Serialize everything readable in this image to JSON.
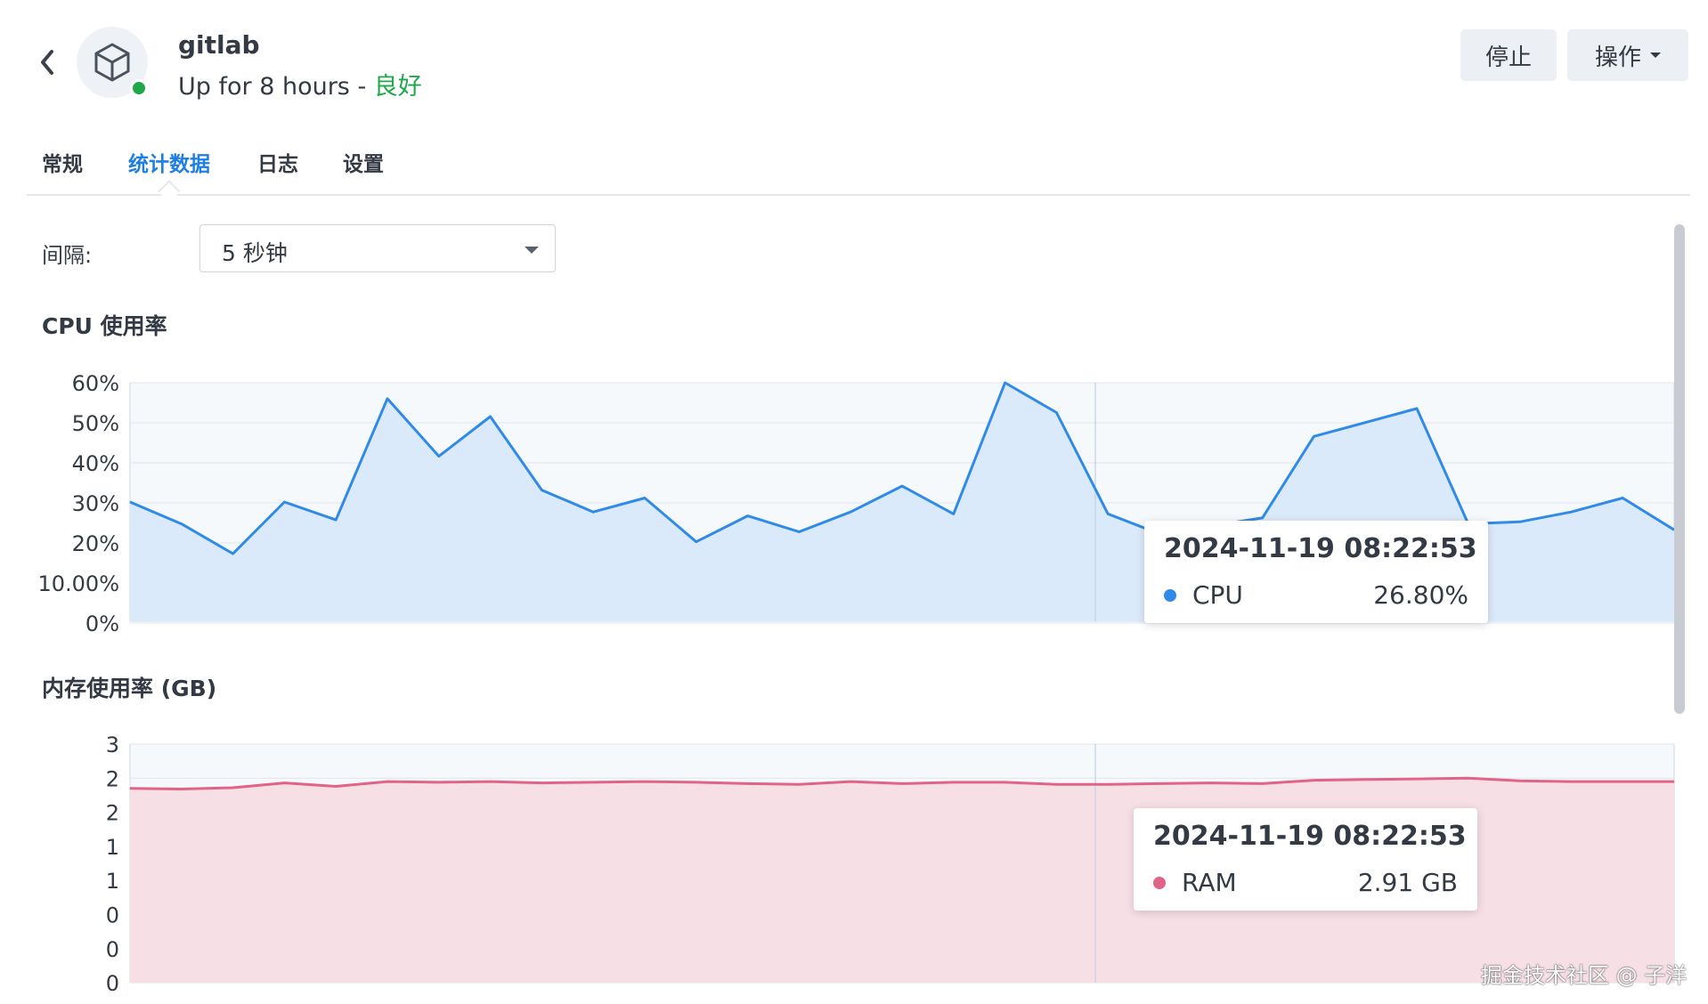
{
  "header": {
    "app_name": "gitlab",
    "status_text": "Up for 8 hours - ",
    "health": "良好",
    "stop_label": "停止",
    "action_label": "操作",
    "health_color": "#1ea84a"
  },
  "tabs": [
    {
      "label": "常规"
    },
    {
      "label": "统计数据",
      "active": true
    },
    {
      "label": "日志"
    },
    {
      "label": "设置"
    }
  ],
  "interval": {
    "label": "间隔:",
    "value": "5 秒钟"
  },
  "cpu": {
    "title": "CPU 使用率",
    "tooltip": {
      "time": "2024-11-19 08:22:53",
      "series": "CPU",
      "value": "26.80%",
      "color": "#2f8ae8"
    }
  },
  "memory": {
    "title": "内存使用率 (GB)",
    "tooltip": {
      "time": "2024-11-19 08:22:53",
      "series": "RAM",
      "value": "2.91 GB",
      "color": "#e36387"
    }
  },
  "chart_data": [
    {
      "type": "area",
      "title": "CPU 使用率",
      "ylim": [
        0,
        60
      ],
      "ytick_labels": [
        "60%",
        "50%",
        "40%",
        "30%",
        "20%",
        "10.00%",
        "0%"
      ],
      "grid": true,
      "series": [
        {
          "name": "CPU",
          "color": "#2f8ae8",
          "values": [
            30,
            24.5,
            17,
            30,
            25.5,
            56,
            41.5,
            51.5,
            33,
            27.5,
            31,
            20,
            26.5,
            22.5,
            27.5,
            34,
            27,
            60,
            52.5,
            27,
            22,
            24,
            26,
            46.5,
            50,
            53.5,
            24.5,
            25,
            27.5,
            31,
            23
          ]
        }
      ]
    },
    {
      "type": "area",
      "title": "内存使用率 (GB)",
      "ylim": [
        0,
        3.5
      ],
      "ytick_labels": [
        "3",
        "2",
        "2",
        "1",
        "1",
        "0",
        "0",
        "0"
      ],
      "grid": true,
      "series": [
        {
          "name": "RAM",
          "color": "#e36387",
          "values": [
            2.85,
            2.84,
            2.86,
            2.93,
            2.88,
            2.95,
            2.94,
            2.95,
            2.93,
            2.94,
            2.95,
            2.94,
            2.92,
            2.91,
            2.95,
            2.92,
            2.94,
            2.94,
            2.91,
            2.91,
            2.92,
            2.93,
            2.92,
            2.97,
            2.98,
            2.99,
            3.0,
            2.96,
            2.95,
            2.95,
            2.95
          ]
        }
      ]
    }
  ],
  "watermark": "掘金技术社区 @ 子洋"
}
